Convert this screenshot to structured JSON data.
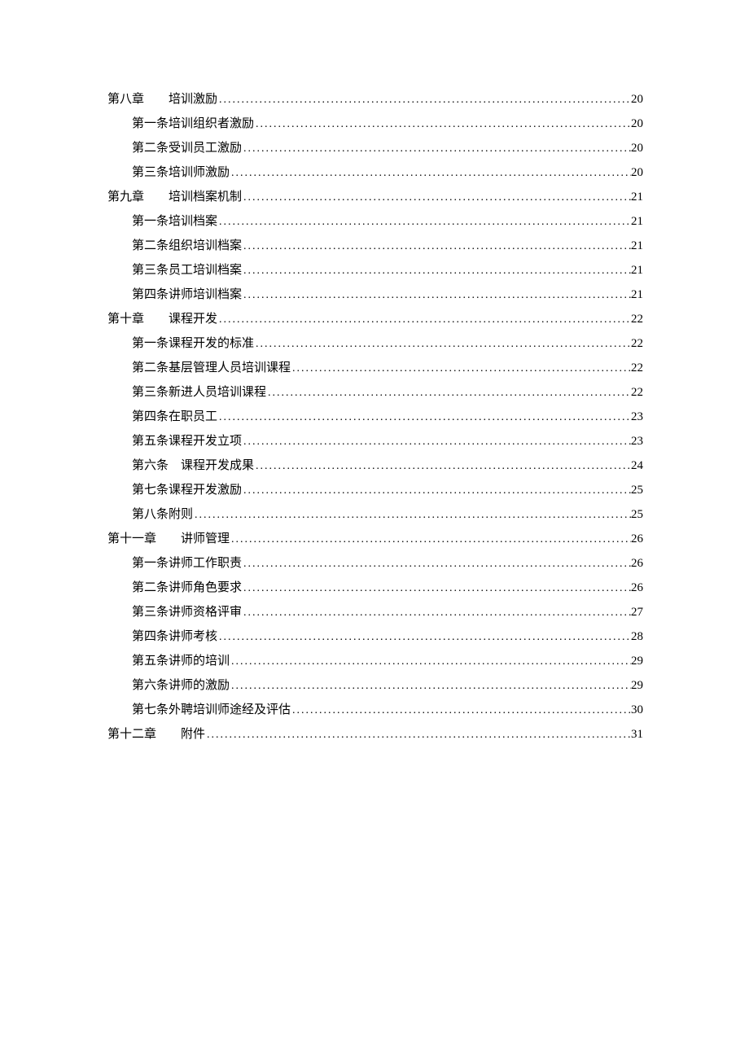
{
  "toc": [
    {
      "level": 1,
      "label": "第八章",
      "title": "培训激励",
      "page": "20",
      "spacer": "　　"
    },
    {
      "level": 2,
      "label": "第一条",
      "title": "培训组织者激励",
      "page": "20",
      "spacer": " "
    },
    {
      "level": 2,
      "label": "第二条",
      "title": "受训员工激励",
      "page": "20",
      "spacer": " "
    },
    {
      "level": 2,
      "label": "第三条",
      "title": "培训师激励",
      "page": "20",
      "spacer": " "
    },
    {
      "level": 1,
      "label": "第九章",
      "title": "培训档案机制",
      "page": "21",
      "spacer": "　　"
    },
    {
      "level": 2,
      "label": "第一条",
      "title": "培训档案",
      "page": "21",
      "spacer": " "
    },
    {
      "level": 2,
      "label": "第二条",
      "title": "组织培训档案",
      "page": "21",
      "spacer": " "
    },
    {
      "level": 2,
      "label": "第三条",
      "title": "员工培训档案",
      "page": "21",
      "spacer": " "
    },
    {
      "level": 2,
      "label": "第四条",
      "title": "讲师培训档案",
      "page": "21",
      "spacer": " "
    },
    {
      "level": 1,
      "label": "第十章",
      "title": "课程开发",
      "page": "22",
      "spacer": "　　"
    },
    {
      "level": 2,
      "label": "第一条",
      "title": "课程开发的标准",
      "page": "22",
      "spacer": " "
    },
    {
      "level": 2,
      "label": "第二条",
      "title": "基层管理人员培训课程",
      "page": "22",
      "spacer": " "
    },
    {
      "level": 2,
      "label": "第三条",
      "title": "新进人员培训课程",
      "page": "22",
      "spacer": " "
    },
    {
      "level": 2,
      "label": "第四条",
      "title": "在职员工",
      "page": "23",
      "spacer": " "
    },
    {
      "level": 2,
      "label": "第五条",
      "title": "课程开发立项",
      "page": "23",
      "spacer": " "
    },
    {
      "level": 2,
      "label": "第六条",
      "title": "课程开发成果",
      "page": "24",
      "spacer": "　"
    },
    {
      "level": 2,
      "label": "第七条",
      "title": "课程开发激励",
      "page": "25",
      "spacer": " "
    },
    {
      "level": 2,
      "label": "第八条",
      "title": "附则",
      "page": "25",
      "spacer": " "
    },
    {
      "level": 1,
      "label": "第十一章",
      "title": "讲师管理",
      "page": "26",
      "spacer": "　　"
    },
    {
      "level": 2,
      "label": "第一条",
      "title": "讲师工作职责",
      "page": "26",
      "spacer": " "
    },
    {
      "level": 2,
      "label": "第二条",
      "title": "讲师角色要求",
      "page": "26",
      "spacer": " "
    },
    {
      "level": 2,
      "label": "第三条",
      "title": "讲师资格评审",
      "page": "27",
      "spacer": " "
    },
    {
      "level": 2,
      "label": "第四条",
      "title": "讲师考核",
      "page": "28",
      "spacer": " "
    },
    {
      "level": 2,
      "label": "第五条",
      "title": "讲师的培训",
      "page": "29",
      "spacer": " "
    },
    {
      "level": 2,
      "label": "第六条",
      "title": "讲师的激励",
      "page": "29",
      "spacer": " "
    },
    {
      "level": 2,
      "label": "第七条",
      "title": "外聘培训师途经及评估",
      "page": "30",
      "spacer": " "
    },
    {
      "level": 1,
      "label": "第十二章",
      "title": "附件",
      "page": "31",
      "spacer": "　　"
    }
  ]
}
